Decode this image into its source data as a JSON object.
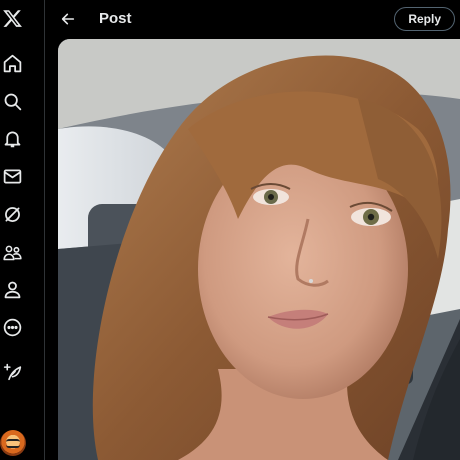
{
  "header": {
    "title": "Post",
    "reply_label": "Reply"
  },
  "nav": {
    "items": [
      {
        "icon": "x-logo-icon"
      },
      {
        "icon": "home-icon"
      },
      {
        "icon": "search-icon"
      },
      {
        "icon": "bell-icon"
      },
      {
        "icon": "mail-icon"
      },
      {
        "icon": "grok-icon"
      },
      {
        "icon": "communities-icon"
      },
      {
        "icon": "profile-icon"
      },
      {
        "icon": "more-icon"
      },
      {
        "icon": "compose-post-icon"
      }
    ]
  },
  "colors": {
    "background": "#000000",
    "text": "#e7e9ea",
    "border": "#536471"
  }
}
